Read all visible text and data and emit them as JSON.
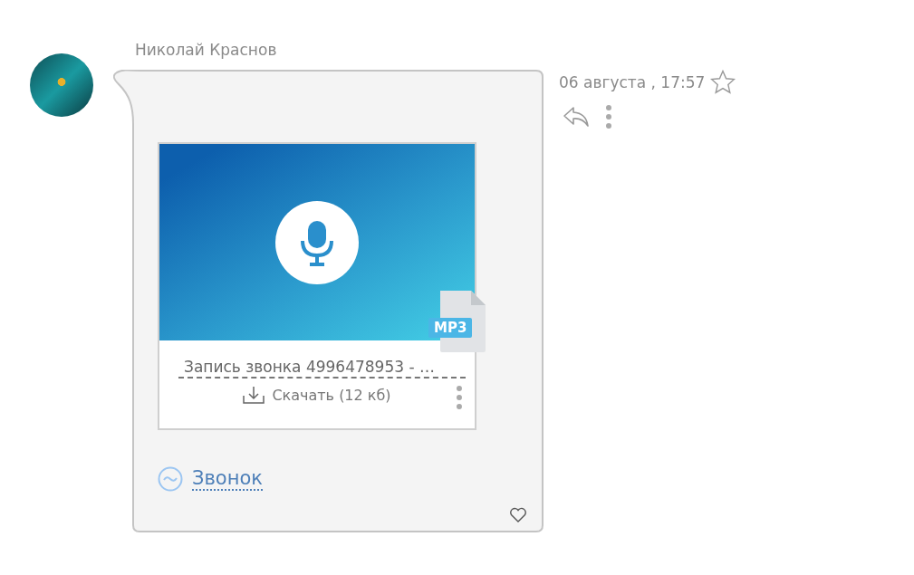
{
  "message": {
    "author": "Николай Краснов",
    "time": "06 августа , 17:57",
    "starred": false,
    "liked": false,
    "attachment": {
      "badge": "MP3",
      "file_name": "Запись звонка 4996478953 - …",
      "download": "Скачать (12 кб)"
    },
    "call_link": "Звонок"
  }
}
